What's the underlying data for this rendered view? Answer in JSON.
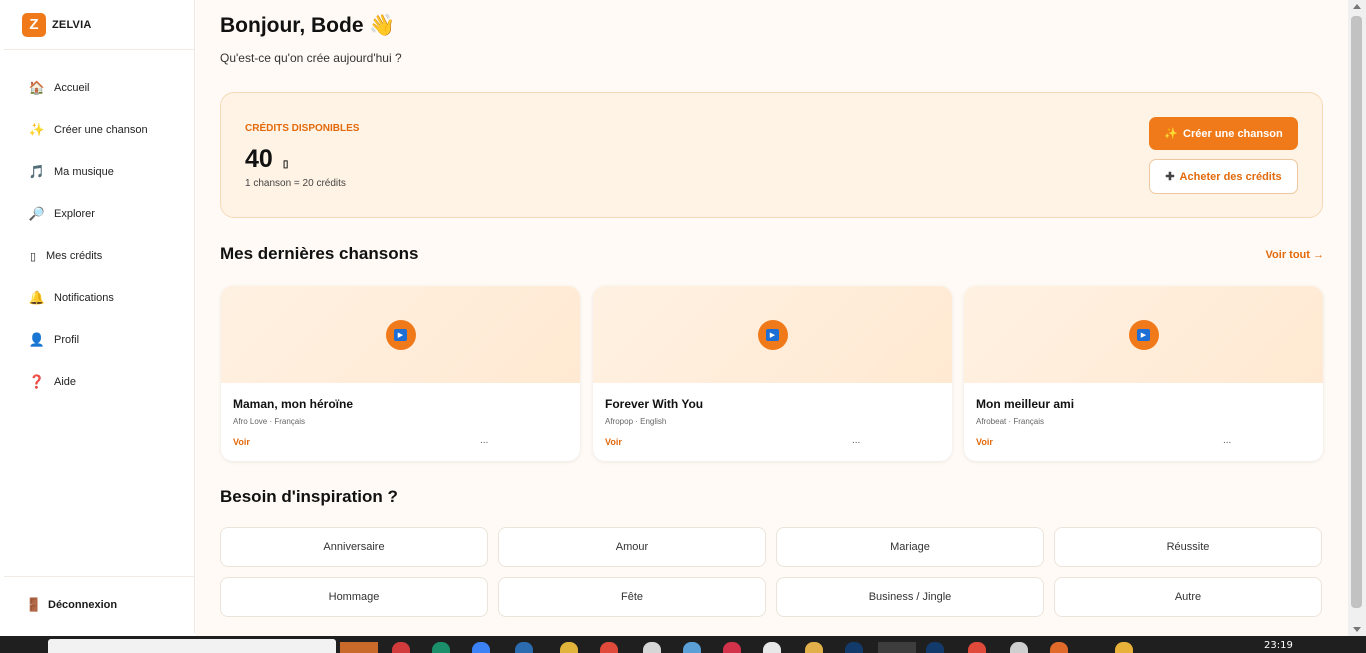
{
  "brand": {
    "logo_letter": "Z",
    "name": "ZELVIA"
  },
  "sidebar": {
    "items": [
      {
        "icon": "🏠",
        "label": "Accueil"
      },
      {
        "icon": "✨",
        "label": "Créer une chanson"
      },
      {
        "icon": "🎵",
        "label": "Ma musique"
      },
      {
        "icon": "🔎",
        "label": "Explorer"
      },
      {
        "icon": "▯",
        "label": "Mes crédits"
      },
      {
        "icon": "🔔",
        "label": "Notifications"
      },
      {
        "icon": "👤",
        "label": "Profil"
      },
      {
        "icon": "❓",
        "label": "Aide"
      }
    ],
    "logout": {
      "icon": "🚪",
      "label": "Déconnexion"
    }
  },
  "header": {
    "greeting": "Bonjour, Bode 👋",
    "subtitle": "Qu'est-ce qu'on crée aujourd'hui ?"
  },
  "credits": {
    "label": "CRÉDITS DISPONIBLES",
    "count": "40",
    "coin_icon": "▯",
    "note": "1 chanson = 20 crédits",
    "create_icon": "✨",
    "create_label": "Créer une chanson",
    "buy_icon": "✚",
    "buy_label": "Acheter des crédits"
  },
  "recent": {
    "title": "Mes dernières chansons",
    "see_all": "Voir tout →",
    "songs": [
      {
        "title": "Maman, mon héroïne",
        "meta": "Afro Love · Français",
        "link": "Voir",
        "more": "..."
      },
      {
        "title": "Forever With You",
        "meta": "Afropop · English",
        "link": "Voir",
        "more": "..."
      },
      {
        "title": "Mon meilleur ami",
        "meta": "Afrobeat · Français",
        "link": "Voir",
        "more": "..."
      }
    ]
  },
  "inspiration": {
    "title": "Besoin d'inspiration ?",
    "chips": [
      "Anniversaire",
      "Amour",
      "Mariage",
      "Réussite",
      "Hommage",
      "Fête",
      "Business / Jingle",
      "Autre"
    ]
  },
  "taskbar": {
    "time": "23:19"
  },
  "colors": {
    "accent": "#f07a1a",
    "accent_text": "#e26a0c",
    "card_bg": "#fff3e5",
    "page_bg": "#fffaf5"
  }
}
